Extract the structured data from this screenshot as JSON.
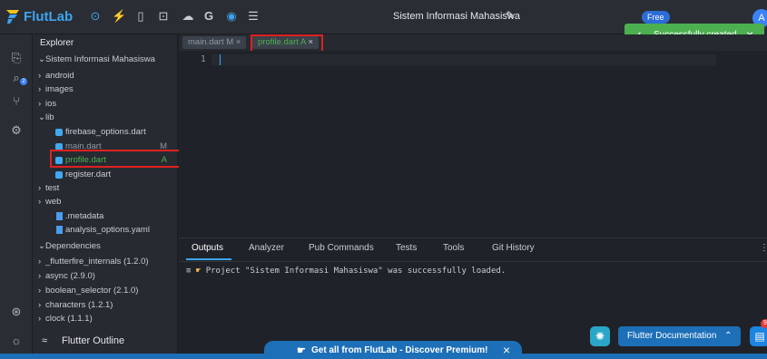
{
  "app": {
    "brand": "FlutLab",
    "project_title": "Sistem Informasi Mahasiswa",
    "plan_badge": "Free",
    "avatar_letter": "A"
  },
  "toast": {
    "message": "Successfully created",
    "color": "#4caf50"
  },
  "explorer": {
    "title": "Explorer",
    "root": "Sistem Informasi Mahasiswa",
    "items": [
      {
        "label": "android",
        "kind": "folder-collapsed"
      },
      {
        "label": "images",
        "kind": "folder-collapsed"
      },
      {
        "label": "ios",
        "kind": "folder-collapsed"
      },
      {
        "label": "lib",
        "kind": "folder-expanded"
      },
      {
        "label": "firebase_options.dart",
        "kind": "dart-file"
      },
      {
        "label": "main.dart",
        "kind": "dart-file",
        "status": "M"
      },
      {
        "label": "profile.dart",
        "kind": "dart-file",
        "status": "A"
      },
      {
        "label": "register.dart",
        "kind": "dart-file"
      },
      {
        "label": "test",
        "kind": "folder-collapsed"
      },
      {
        "label": "web",
        "kind": "folder-collapsed"
      },
      {
        "label": ".metadata",
        "kind": "file"
      },
      {
        "label": "analysis_options.yaml",
        "kind": "file"
      }
    ],
    "dependencies_title": "Dependencies",
    "dependencies": [
      "_flutterfire_internals (1.2.0)",
      "async (2.9.0)",
      "boolean_selector (2.1.0)",
      "characters (1.2.1)",
      "clock (1.1.1)"
    ],
    "outline_title": "Flutter Outline"
  },
  "editor": {
    "tabs": [
      {
        "label": "main.dart M",
        "status_color": "#8f98a3"
      },
      {
        "label": "profile.dart A",
        "status_color": "#4caf50"
      }
    ],
    "line_numbers": [
      "1"
    ]
  },
  "panel": {
    "tabs": [
      "Outputs",
      "Analyzer",
      "Pub Commands",
      "Tests",
      "Tools",
      "Git History"
    ],
    "output_line": "Project \"Sistem Informasi Mahasiswa\" was successfully loaded."
  },
  "floating": {
    "docs_label": "Flutter Documentation",
    "chat_badge": "9"
  },
  "premium_banner": "Get all from FlutLab - Discover Premium!",
  "colors": {
    "accent": "#3ea4f0",
    "highlight_box": "#e02020",
    "added": "#4caf50",
    "banner": "#1d6fb8"
  }
}
